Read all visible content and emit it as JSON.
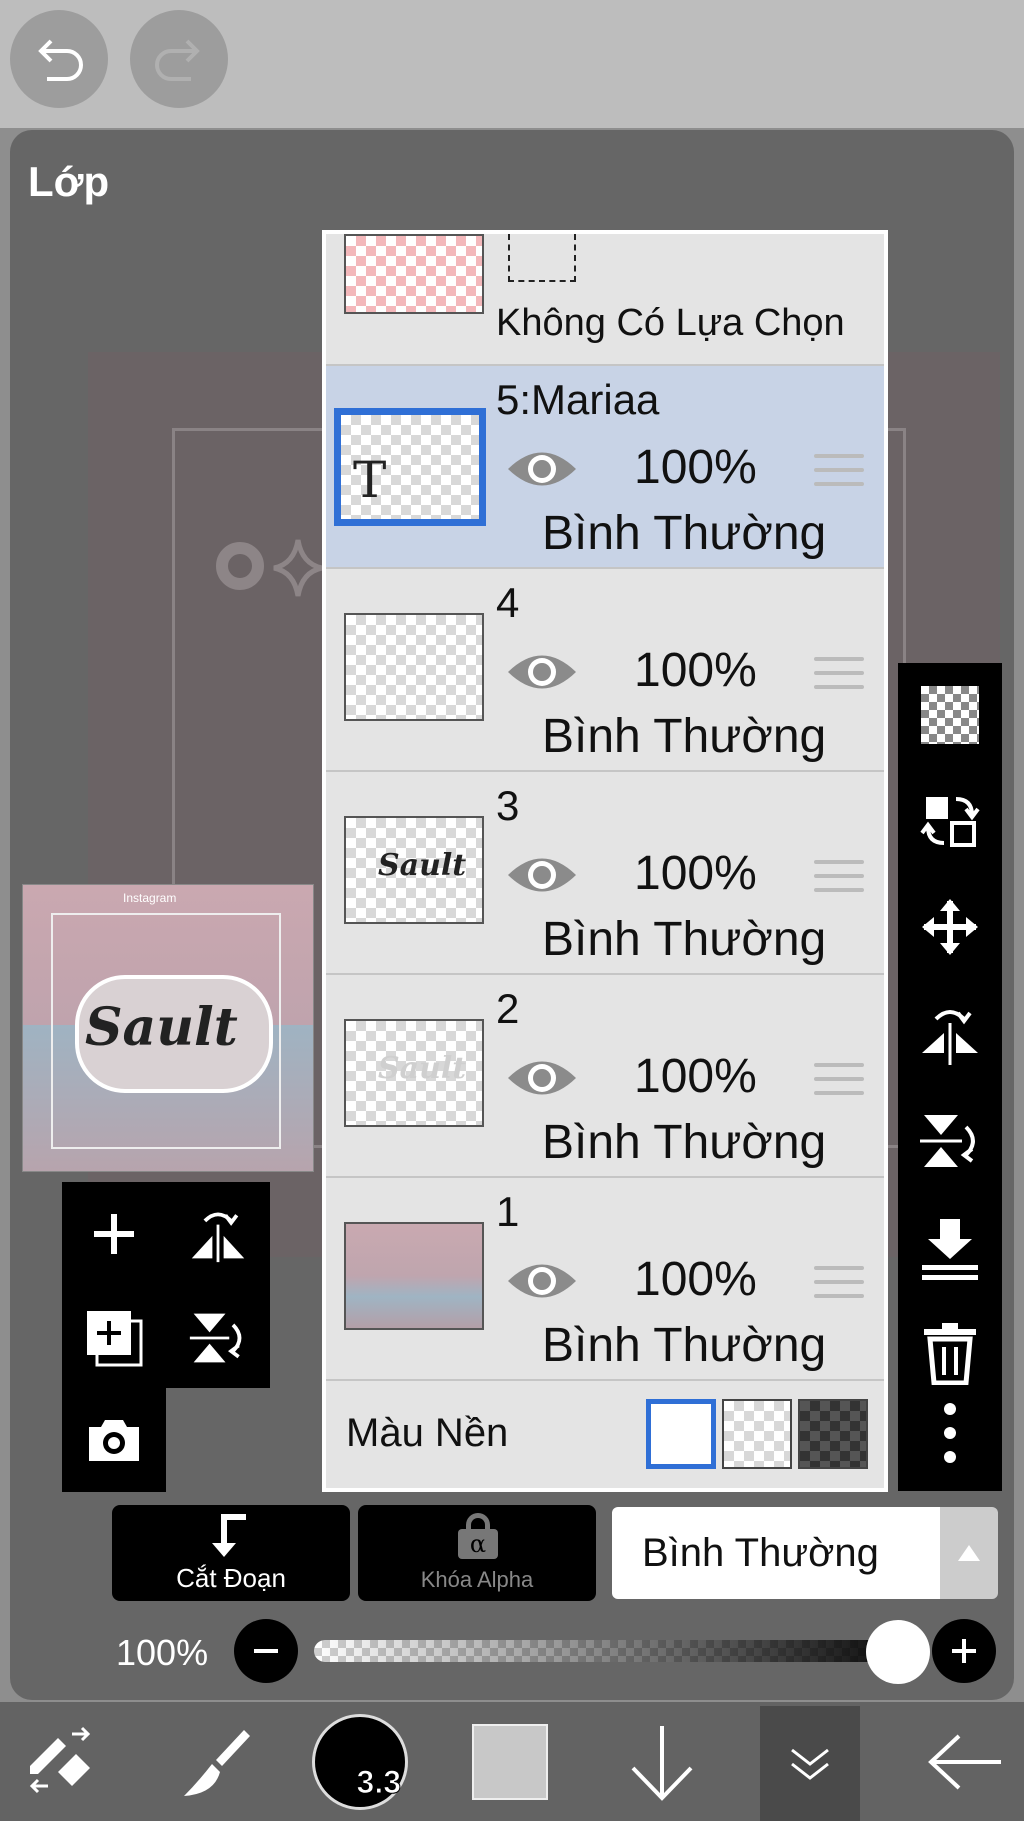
{
  "panel": {
    "title": "Lớp"
  },
  "selection_layer": {
    "label": "Không Có Lựa Chọn"
  },
  "layers": [
    {
      "name": "5:Mariaa",
      "opacity": "100%",
      "blend": "Bình Thường",
      "selected": true,
      "thumb_text": "T"
    },
    {
      "name": "4",
      "opacity": "100%",
      "blend": "Bình Thường",
      "selected": false
    },
    {
      "name": "3",
      "opacity": "100%",
      "blend": "Bình Thường",
      "selected": false,
      "thumb_text": "Sault"
    },
    {
      "name": "2",
      "opacity": "100%",
      "blend": "Bình Thường",
      "selected": false,
      "thumb_text": "Sault"
    },
    {
      "name": "1",
      "opacity": "100%",
      "blend": "Bình Thường",
      "selected": false
    }
  ],
  "background": {
    "label": "Màu Nền"
  },
  "actions": {
    "clip_label": "Cắt Đoạn",
    "alpha_lock_label": "Khóa Alpha",
    "alpha_symbol": "α"
  },
  "blend_mode": {
    "value": "Bình Thường"
  },
  "opacity": {
    "label": "100%",
    "value": 1.0
  },
  "brush_size": "3.3",
  "preview": {
    "header": "Instagram",
    "word": "Sault"
  },
  "accent_color": "#2f6fd6",
  "icons": [
    "undo-icon",
    "redo-icon",
    "checker-icon",
    "swap-icon",
    "move-icon",
    "flip-h-icon",
    "flip-v-icon",
    "merge-down-icon",
    "trash-icon",
    "more-icon",
    "add-layer-icon",
    "flip-h-rotate-icon",
    "duplicate-layer-icon",
    "flip-v-rotate-icon",
    "camera-icon",
    "transform-icon",
    "brush-icon",
    "color-icon",
    "down-arrow-icon",
    "double-chevron-icon",
    "back-arrow-icon"
  ]
}
